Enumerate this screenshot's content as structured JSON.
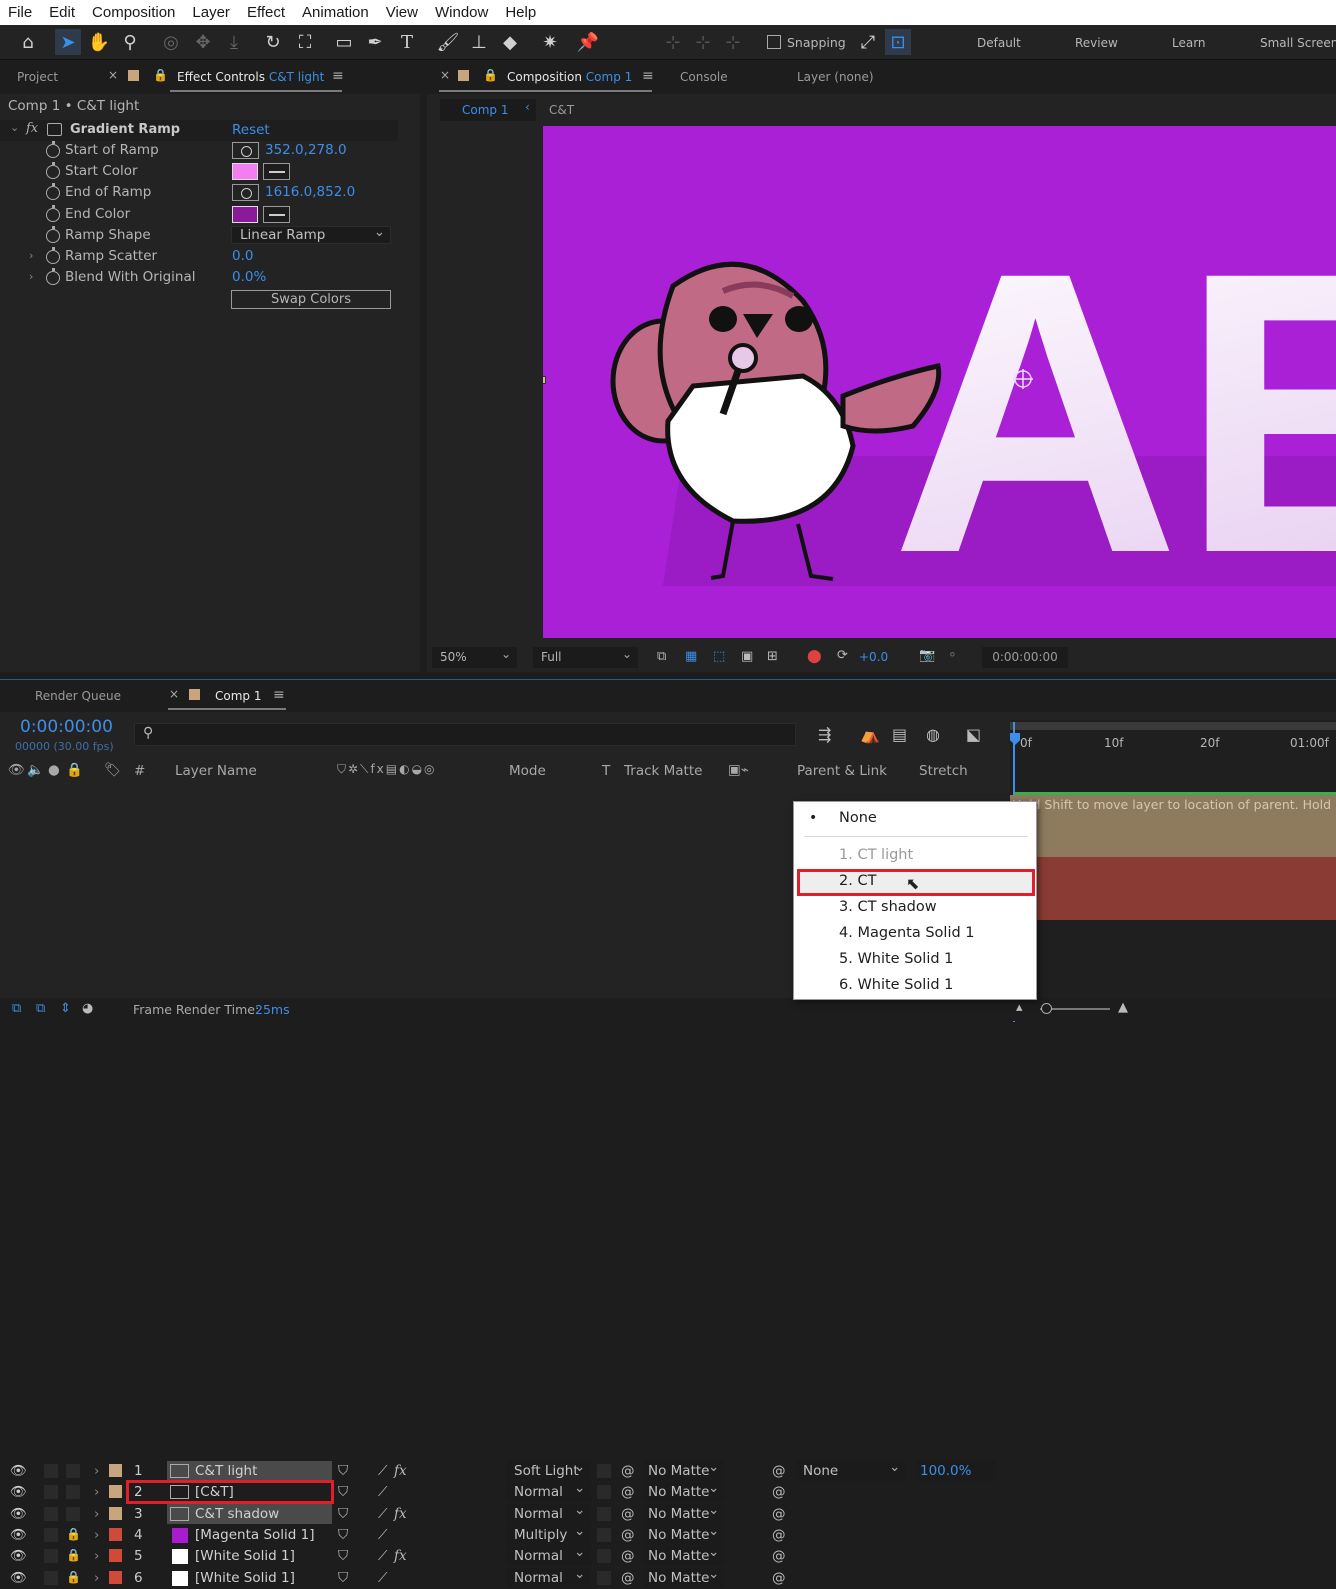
{
  "menubar": [
    "File",
    "Edit",
    "Composition",
    "Layer",
    "Effect",
    "Animation",
    "View",
    "Window",
    "Help"
  ],
  "toolbar": {
    "snapping_label": "Snapping",
    "workspaces": [
      "Default",
      "Review",
      "Learn",
      "Small Screen"
    ]
  },
  "left_panel": {
    "tabs": {
      "project": "Project",
      "effect_controls": "Effect Controls",
      "effect_controls_layer": "C&T light"
    },
    "breadcrumb": "Comp 1 • C&T light",
    "effect": {
      "fx": "fx",
      "name": "Gradient Ramp",
      "reset": "Reset"
    },
    "properties": [
      {
        "label": "Start of Ramp",
        "value": "352.0,278.0"
      },
      {
        "label": "Start Color",
        "value": "",
        "color": "#f27ef2"
      },
      {
        "label": "End of Ramp",
        "value": "1616.0,852.0"
      },
      {
        "label": "End Color",
        "value": "",
        "color": "#8a1a9a"
      },
      {
        "label": "Ramp Shape",
        "value": "Linear Ramp"
      },
      {
        "label": "Ramp Scatter",
        "value": "0.0"
      },
      {
        "label": "Blend With Original",
        "value": "0.0%"
      }
    ],
    "swap_button": "Swap Colors"
  },
  "comp_panel": {
    "tabs": {
      "composition": "Composition",
      "comp_name": "Comp 1",
      "console": "Console",
      "layer": "Layer (none)"
    },
    "crumbs": [
      "Comp 1",
      "C&T"
    ],
    "footer": {
      "zoom": "50%",
      "resolution": "Full",
      "exposure": "+0.0",
      "timecode": "0:00:00:00"
    },
    "viewer_bg": "#a920d6",
    "letters": "AE"
  },
  "timeline": {
    "tabs": {
      "render_queue": "Render Queue",
      "comp": "Comp 1"
    },
    "timecode": "0:00:00:00",
    "fps": "00000 (30.00 fps)",
    "headers": {
      "num": "#",
      "layer_name": "Layer Name",
      "mode": "Mode",
      "t": "T",
      "track_matte": "Track Matte",
      "parent": "Parent & Link",
      "stretch": "Stretch"
    },
    "layers": [
      {
        "num": "1",
        "name": "C&T light",
        "mode": "Soft Light",
        "matte": "No Matte",
        "label_color": "#c8a57c",
        "fx": true,
        "locked": false
      },
      {
        "num": "2",
        "name": "[C&T]",
        "mode": "Normal",
        "matte": "No Matte",
        "label_color": "#c8a57c",
        "fx": false,
        "locked": false
      },
      {
        "num": "3",
        "name": "C&T shadow",
        "mode": "Normal",
        "matte": "No Matte",
        "label_color": "#c8a57c",
        "fx": true,
        "locked": false
      },
      {
        "num": "4",
        "name": "[Magenta Solid 1]",
        "mode": "Multiply",
        "matte": "No Matte",
        "label_color": "#d04a3a",
        "fx": false,
        "locked": true,
        "swatch": "#a81cd0"
      },
      {
        "num": "5",
        "name": "[White Solid 1]",
        "mode": "Normal",
        "matte": "No Matte",
        "label_color": "#d04a3a",
        "fx": true,
        "locked": true,
        "swatch": "#ffffff"
      },
      {
        "num": "6",
        "name": "[White Solid 1]",
        "mode": "Normal",
        "matte": "No Matte",
        "label_color": "#d04a3a",
        "fx": false,
        "locked": true,
        "swatch": "#ffffff"
      }
    ],
    "parent_value": "None",
    "stretch_value": "100.0%",
    "ruler": [
      "0f",
      "10f",
      "20f",
      "01:00f"
    ],
    "tooltip": "Hold Shift to move layer to location of parent. Hold",
    "frame_render_label": "Frame Render Time:",
    "frame_render_value": "25ms"
  },
  "parent_menu": {
    "items": [
      {
        "label": "None",
        "bullet": "•"
      },
      {
        "label": "1. CT light",
        "disabled": true
      },
      {
        "label": "2. CT",
        "highlighted": true
      },
      {
        "label": "3. CT shadow"
      },
      {
        "label": "4. Magenta Solid 1"
      },
      {
        "label": "5. White Solid 1"
      },
      {
        "label": "6. White Solid 1"
      }
    ]
  }
}
